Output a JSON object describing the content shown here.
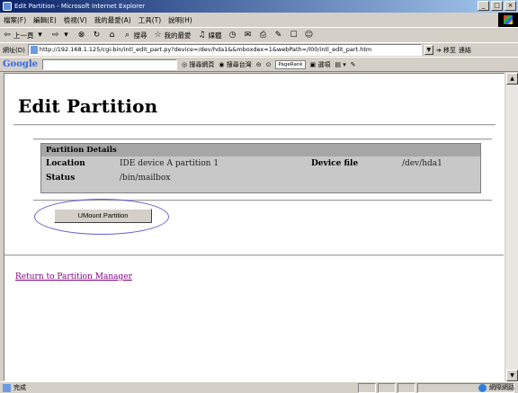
{
  "window": {
    "title": "Edit Partition - Microsoft Internet Explorer",
    "buttons": {
      "minimize": "_",
      "maximize": "□",
      "close": "×"
    }
  },
  "menu": {
    "items": [
      "檔案(F)",
      "編輯(E)",
      "檢視(V)",
      "我的最愛(A)",
      "工具(T)",
      "說明(H)"
    ]
  },
  "toolbar": {
    "back": "上一頁",
    "search": "搜尋",
    "favorites": "我的最愛",
    "media": "媒體"
  },
  "address": {
    "label": "網址(D)",
    "url": "http://192.168.1.125/cgi-bin/intl_edit_part.py?device=/dev/hda1&&mboxdex=1&webPath=/l00/intl_edit_part.htm",
    "go": "移至",
    "links": "連結"
  },
  "googlebar": {
    "logo": "Google",
    "search_web": "搜尋網頁",
    "search_tw": "搜尋台灣",
    "pagerank": "PageRank",
    "options": "選項"
  },
  "page": {
    "title": "Edit Partition",
    "details": {
      "heading": "Partition Details",
      "location_label": "Location",
      "location_value": "IDE device A partition 1",
      "device_label": "Device file",
      "device_value": "/dev/hda1",
      "status_label": "Status",
      "status_value": "/bin/mailbox"
    },
    "umount_button": "UMount Partition",
    "return_link": "Return to Partition Manager"
  },
  "status": {
    "left": "完成",
    "zone": "網際網路"
  }
}
